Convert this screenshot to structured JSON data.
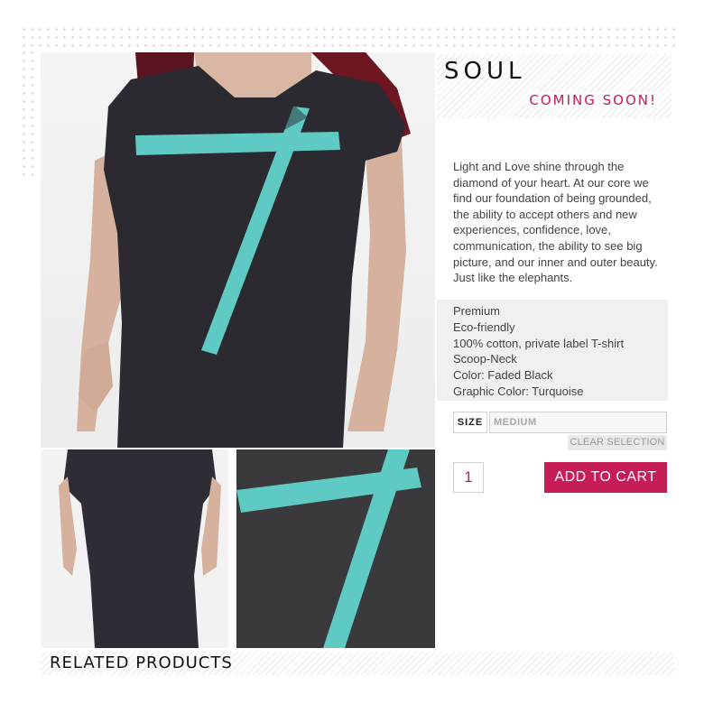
{
  "product": {
    "title": "SOUL",
    "status": "COMING SOON!",
    "description": "Light and Love shine through the diamond of your heart. At our core we find our foundation of being grounded, the ability to accept others and new experiences, confidence, love, communication, the ability to see big picture, and our inner and outer beauty. Just like the elephants.",
    "features": [
      "Premium",
      "Eco-friendly",
      "100% cotton, private label T-shirt",
      "Scoop-Neck",
      "Color: Faded Black",
      "Graphic Color: Turquoise"
    ]
  },
  "options": {
    "size_label": "SIZE",
    "size_value": "MEDIUM",
    "clear_label": "CLEAR SELECTION",
    "quantity": "1",
    "add_to_cart_label": "ADD TO CART"
  },
  "related": {
    "heading": "RELATED PRODUCTS"
  },
  "colors": {
    "accent": "#c71c5a",
    "graphic": "#5fc9c3",
    "shirt": "#2b2a30"
  }
}
